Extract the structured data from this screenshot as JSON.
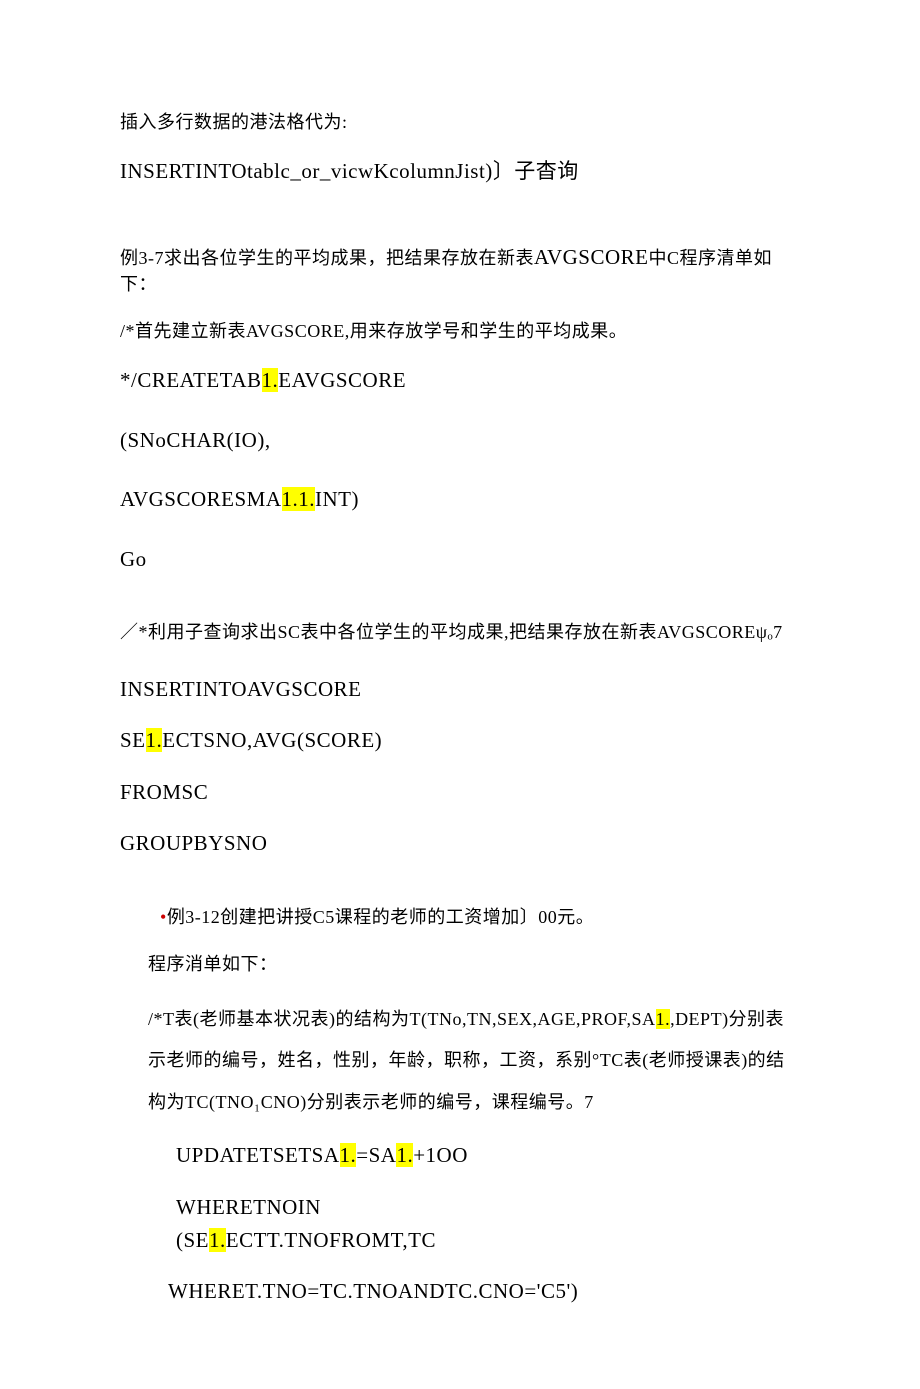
{
  "l1": "插入多行数据的港法格代为:",
  "l2a": "INSERTINTOtablc_or_vicwKcolumnJist)",
  "l2b": "〕子杳询",
  "l3a": "例3-7求出各位学生的平均成果，把结果存放在新表",
  "l3b": "AVGSCORE",
  "l3c": "中C程序清单如下：",
  "l4": "/*首先建立新表AVGSCORE,用来存放学号和学生的平均成果。",
  "l5a": "*/CREATETAB",
  "l5b": "1.",
  "l5c": "EAVGSCORE",
  "l6": "(SNoCHAR(IO),",
  "l7a": "AVGSCORESMA",
  "l7b": "1.1.",
  "l7c": "INT)",
  "l8": "Go",
  "l9": "／*利用子查询求出SC表中各位学生的平均成果,把结果存放在新表AVGSCOREψₒ7",
  "l10": "INSERTINTOAVGSCORE",
  "l11a": "SE",
  "l11b": "1.",
  "l11c": "ECTSNO,AVG(SCORE)",
  "l12": "FROMSC",
  "l13": "GROUPBYSNO",
  "l14a": "•",
  "l14b": "例3-12创建把讲授C5课程的老师的工资增加〕00元。",
  "l15": "程序消单如下：",
  "l16a": "/*T表(老师基本状况表)的结构为T(TNo,TN,SEX,AGE,PROF,SA",
  "l16b": "1.",
  "l16c": ",DEPT)分别表示老师的编号，姓名，性别，年龄，职称，工资，系别°TC表(老师授课表)的结构为TC(TNO₁CNO)分别表示老师的编号，课程编号。7",
  "l17a": "UPDATETSETSA",
  "l17b": "1.",
  "l17c": "=SA",
  "l17d": "1.",
  "l17e": "+1OO",
  "l18": "WHERETNOIN",
  "l19a": "(SE",
  "l19b": "1.",
  "l19c": "ECTT.TNOFROMT,TC",
  "l20": "WHERET.TNO=TC.TNOANDTC.CNO='C5')"
}
